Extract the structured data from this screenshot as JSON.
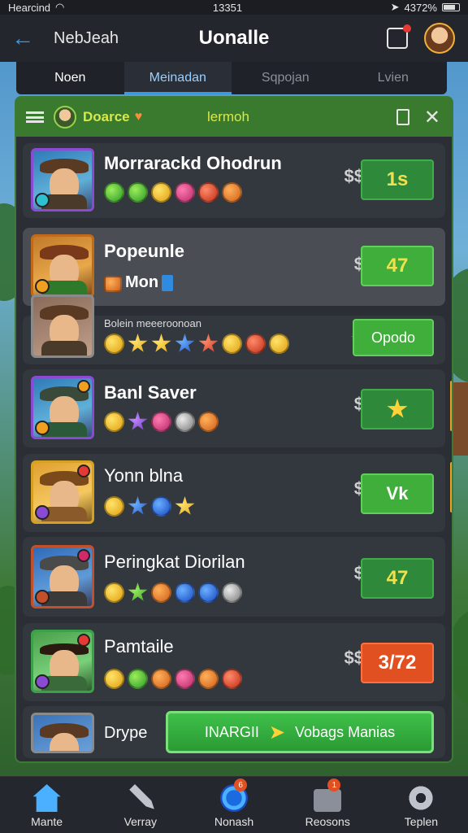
{
  "status_bar": {
    "carrier": "Hearcind",
    "time": "13351",
    "battery": "4372%"
  },
  "header": {
    "back_label": "NebJeah",
    "title": "Uonalle"
  },
  "tabs": [
    "Noen",
    "Meinadan",
    "Sqpojan",
    "Lvien"
  ],
  "panel": {
    "guild_name": "Doarce",
    "center_label": "lermoh"
  },
  "rows": [
    {
      "name": "Morrarackd Ohodrun",
      "price_icon": "$$",
      "button": "1s",
      "gems": [
        "green",
        "green",
        "gold",
        "pink",
        "red",
        "orange"
      ]
    },
    {
      "name": "Popeunle",
      "subtitle": "Mon",
      "price_icon": "$",
      "button": "47",
      "gems": []
    },
    {
      "name": "Bolein meeeroonoan",
      "button": "Opodo",
      "gems": [
        "gold",
        "gold",
        "gold",
        "blue",
        "red",
        "gold",
        "red",
        "gold"
      ]
    },
    {
      "name": "Banl Saver",
      "price_icon": "$",
      "button": "",
      "gems": [
        "gold",
        "purple",
        "pink",
        "silver",
        "orange"
      ]
    },
    {
      "name": "Yonn blna",
      "price_icon": "$",
      "button": "Vk",
      "gems": [
        "gold",
        "blue",
        "blue",
        "gold"
      ]
    },
    {
      "name": "Peringkat Diorilan",
      "price_icon": "$",
      "button": "47",
      "gems": [
        "gold",
        "green",
        "orange",
        "blue",
        "blue",
        "silver"
      ]
    },
    {
      "name": "Pamtaile",
      "price_icon": "$$",
      "button": "3/72",
      "gems": [
        "gold",
        "green",
        "orange",
        "pink",
        "orange",
        "red"
      ]
    },
    {
      "name": "Drype",
      "cta_left": "INARGII",
      "cta_right": "Vobags Manias"
    }
  ],
  "bottom_nav": [
    {
      "label": "Mante",
      "icon": "home-icon"
    },
    {
      "label": "Verray",
      "icon": "tools-icon"
    },
    {
      "label": "Nonash",
      "icon": "globe-icon",
      "badge": "6"
    },
    {
      "label": "Reosons",
      "icon": "box-icon",
      "badge": "1"
    },
    {
      "label": "Teplen",
      "icon": "cog-icon"
    }
  ]
}
